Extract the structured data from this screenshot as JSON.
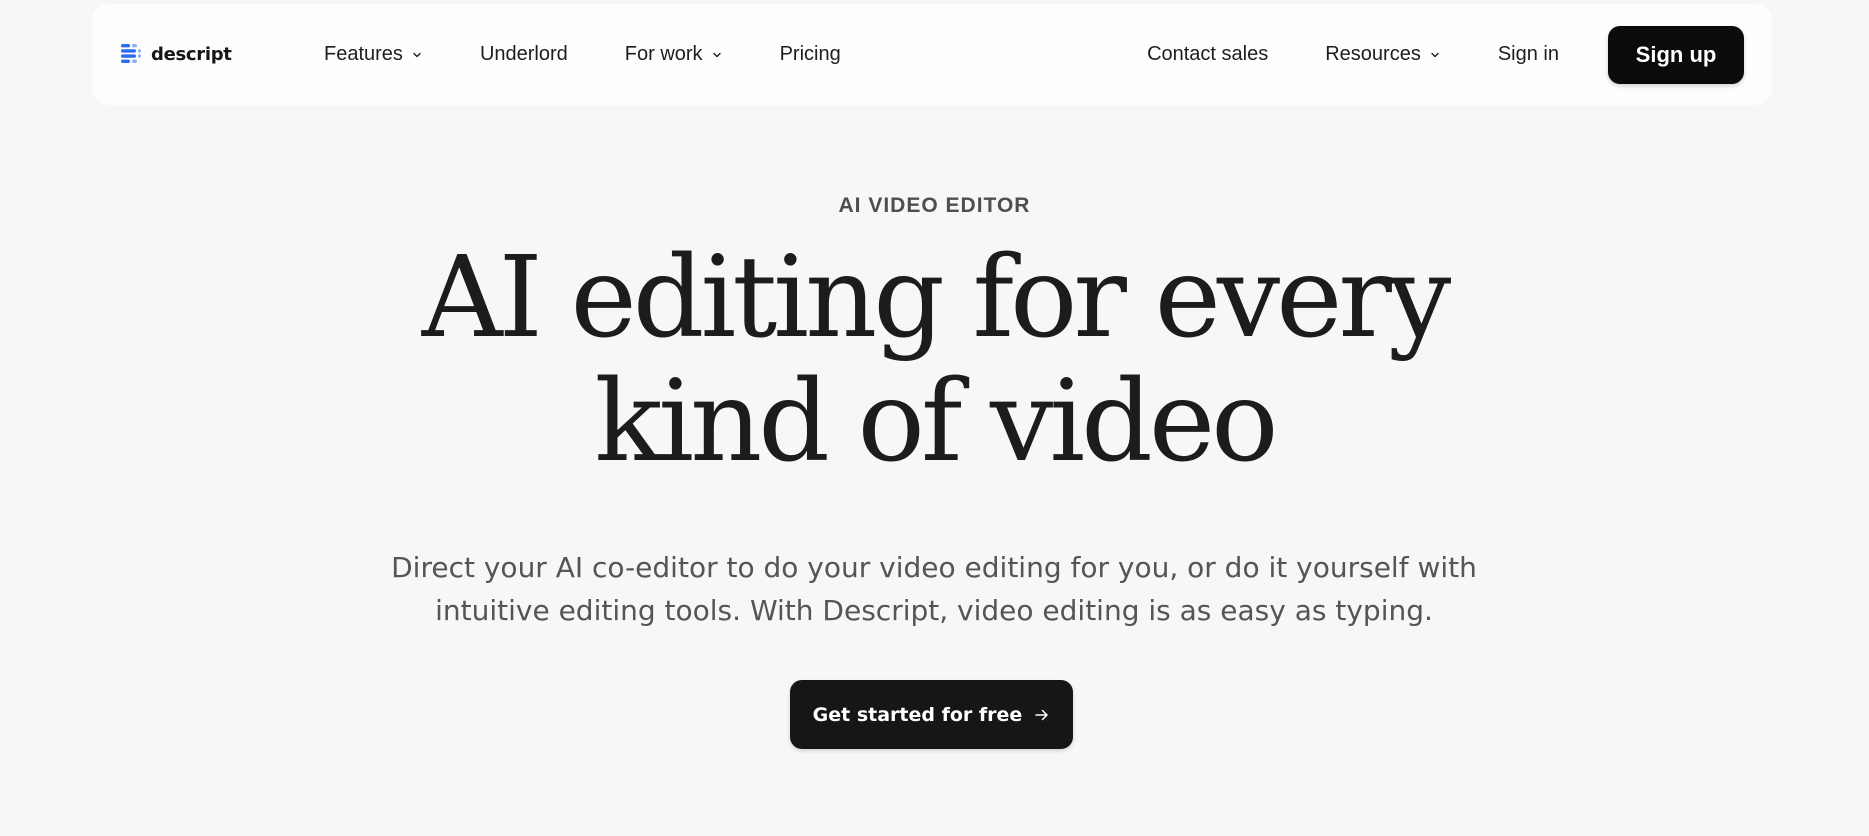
{
  "brand": {
    "name": "descript",
    "logo_icon": "descript-logo-icon",
    "accent_color": "#2b6bf0"
  },
  "nav": {
    "left_items": [
      {
        "label": "Features",
        "has_dropdown": true
      },
      {
        "label": "Underlord",
        "has_dropdown": false
      },
      {
        "label": "For work",
        "has_dropdown": true
      },
      {
        "label": "Pricing",
        "has_dropdown": false
      }
    ],
    "contact_sales": "Contact sales",
    "resources": "Resources",
    "sign_in": "Sign in",
    "sign_up": "Sign up"
  },
  "hero": {
    "eyebrow": "AI VIDEO EDITOR",
    "headline_line1": "AI editing for every",
    "headline_line2": "kind of video",
    "subtitle_line1": "Direct your AI co-editor to do your video editing for you, or do it yourself with",
    "subtitle_line2": "intuitive editing tools. With Descript, video editing is as easy as typing.",
    "cta_label": "Get started for free",
    "cta_icon": "arrow-right-icon"
  }
}
